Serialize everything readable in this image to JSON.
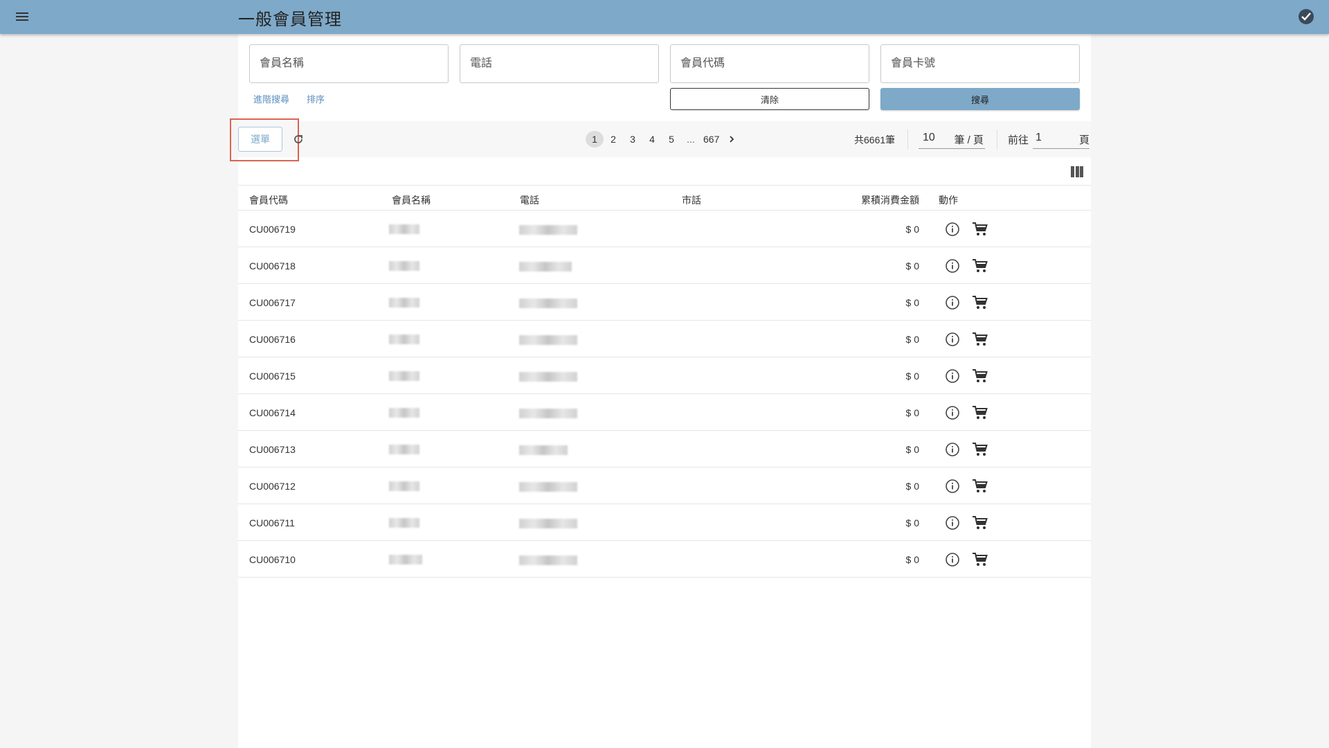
{
  "header": {
    "title": "一般會員管理",
    "menu_icon": "menu-icon",
    "status_icon": "check-circle-icon"
  },
  "search": {
    "name_placeholder": "會員名稱",
    "phone_placeholder": "電話",
    "code_placeholder": "會員代碼",
    "card_placeholder": "會員卡號",
    "advanced_label": "進階搜尋",
    "sort_label": "排序",
    "clear_label": "清除",
    "search_label": "搜尋"
  },
  "toolbar": {
    "menu_label": "選單",
    "refresh_icon": "refresh-icon",
    "pages": [
      "1",
      "2",
      "3",
      "4",
      "5",
      "...",
      "667"
    ],
    "current_page": "1",
    "total_label": "共6661筆",
    "page_size": "10",
    "page_size_unit": "筆 / 頁",
    "goto_label": "前往",
    "goto_value": "1",
    "goto_unit": "頁",
    "columns_icon": "view-column-icon"
  },
  "table": {
    "headers": [
      "會員代碼",
      "會員名稱",
      "電話",
      "市話",
      "累積消費金額",
      "動作"
    ],
    "rows": [
      {
        "code": "CU006719",
        "amount": "$ 0"
      },
      {
        "code": "CU006718",
        "amount": "$ 0"
      },
      {
        "code": "CU006717",
        "amount": "$ 0"
      },
      {
        "code": "CU006716",
        "amount": "$ 0"
      },
      {
        "code": "CU006715",
        "amount": "$ 0"
      },
      {
        "code": "CU006714",
        "amount": "$ 0"
      },
      {
        "code": "CU006713",
        "amount": "$ 0"
      },
      {
        "code": "CU006712",
        "amount": "$ 0"
      },
      {
        "code": "CU006711",
        "amount": "$ 0"
      },
      {
        "code": "CU006710",
        "amount": "$ 0"
      }
    ],
    "action_icons": [
      "info-icon",
      "cart-icon"
    ]
  },
  "colors": {
    "primary": "#7ea9c9",
    "highlight_border": "#d9644f",
    "link": "#5b8fbf"
  }
}
